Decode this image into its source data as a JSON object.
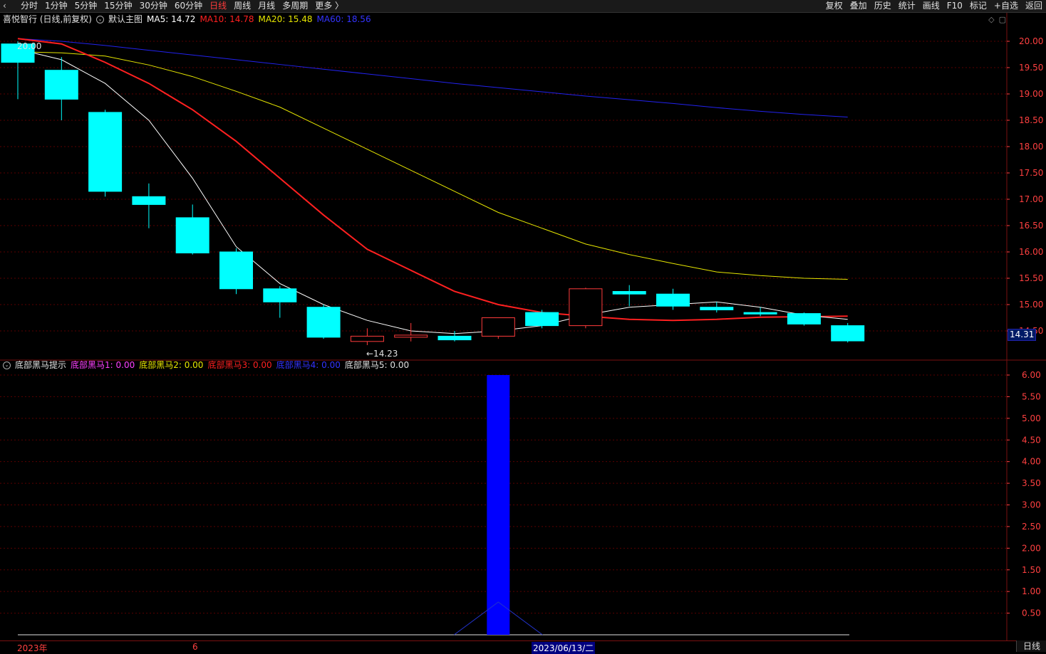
{
  "topbar": {
    "tabs": [
      "分时",
      "1分钟",
      "5分钟",
      "15分钟",
      "30分钟",
      "60分钟",
      "日线",
      "周线",
      "月线",
      "多周期",
      "更多 〉"
    ],
    "active_tab": "日线",
    "tools": [
      "复权",
      "叠加",
      "历史",
      "统计",
      "画线",
      "F10",
      "标记",
      "+自选",
      "返回"
    ]
  },
  "main_legend": {
    "stock": "喜悦智行 (日线,前复权)",
    "template": "默认主图",
    "ma5": "MA5: 14.72",
    "ma10": "MA10: 14.78",
    "ma20": "MA20: 15.48",
    "ma60": "MA60: 18.56"
  },
  "sub_legend": {
    "name": "底部黑马提示",
    "s1": "底部黑马1: 0.00",
    "s2": "底部黑马2: 0.00",
    "s3": "底部黑马3: 0.00",
    "s4": "底部黑马4: 0.00",
    "s5": "底部黑马5: 0.00"
  },
  "annotations": {
    "high": "20.00",
    "low": "←14.23"
  },
  "last_price": "14.31",
  "dates": {
    "year": "2023年",
    "month": "6",
    "cursor": "2023/06/13/二"
  },
  "period_label": "日线",
  "colors": {
    "up": "#ff3b3b",
    "down": "#00ffff",
    "ma5": "#ffffff",
    "ma10": "#ff2020",
    "ma20": "#e6e600",
    "ma60": "#2222ee",
    "grid": "#5a0000",
    "axis": "#ff4040",
    "signal_bar": "#0000ff"
  },
  "chart_data": [
    {
      "type": "candlestick",
      "title": "喜悦智行 (日线,前复权)",
      "ylim": [
        14.0,
        20.25
      ],
      "y_ticks": [
        "20.00",
        "19.50",
        "19.00",
        "18.50",
        "18.00",
        "17.50",
        "17.00",
        "16.50",
        "16.00",
        "15.50",
        "15.00",
        "14.50"
      ],
      "candles": [
        {
          "o": 19.95,
          "h": 20.0,
          "l": 18.9,
          "c": 19.6
        },
        {
          "o": 19.45,
          "h": 19.7,
          "l": 18.5,
          "c": 18.9
        },
        {
          "o": 18.65,
          "h": 18.7,
          "l": 17.05,
          "c": 17.15
        },
        {
          "o": 17.05,
          "h": 17.3,
          "l": 16.45,
          "c": 16.9
        },
        {
          "o": 16.65,
          "h": 16.9,
          "l": 15.95,
          "c": 15.98
        },
        {
          "o": 16.0,
          "h": 16.07,
          "l": 15.2,
          "c": 15.3
        },
        {
          "o": 15.3,
          "h": 15.35,
          "l": 14.75,
          "c": 15.05
        },
        {
          "o": 14.95,
          "h": 15.0,
          "l": 14.35,
          "c": 14.38
        },
        {
          "o": 14.3,
          "h": 14.55,
          "l": 14.23,
          "c": 14.4
        },
        {
          "o": 14.38,
          "h": 14.65,
          "l": 14.3,
          "c": 14.42
        },
        {
          "o": 14.4,
          "h": 14.5,
          "l": 14.3,
          "c": 14.33
        },
        {
          "o": 14.4,
          "h": 14.75,
          "l": 14.35,
          "c": 14.75
        },
        {
          "o": 14.85,
          "h": 14.9,
          "l": 14.55,
          "c": 14.6
        },
        {
          "o": 14.6,
          "h": 15.32,
          "l": 14.55,
          "c": 15.3
        },
        {
          "o": 15.25,
          "h": 15.37,
          "l": 14.97,
          "c": 15.2
        },
        {
          "o": 15.2,
          "h": 15.3,
          "l": 14.9,
          "c": 14.97
        },
        {
          "o": 14.95,
          "h": 15.05,
          "l": 14.85,
          "c": 14.9
        },
        {
          "o": 14.85,
          "h": 14.95,
          "l": 14.78,
          "c": 14.82
        },
        {
          "o": 14.83,
          "h": 14.85,
          "l": 14.6,
          "c": 14.63
        },
        {
          "o": 14.6,
          "h": 14.65,
          "l": 14.28,
          "c": 14.31
        }
      ],
      "ma5": [
        19.85,
        19.65,
        19.2,
        18.5,
        17.4,
        16.1,
        15.4,
        15.0,
        14.7,
        14.5,
        14.45,
        14.5,
        14.6,
        14.8,
        14.95,
        15.0,
        15.05,
        14.95,
        14.8,
        14.72
      ],
      "ma10": [
        20.05,
        19.95,
        19.6,
        19.2,
        18.7,
        18.1,
        17.4,
        16.7,
        16.05,
        15.65,
        15.25,
        15.0,
        14.85,
        14.78,
        14.72,
        14.7,
        14.72,
        14.76,
        14.77,
        14.78
      ],
      "ma20": [
        19.8,
        19.78,
        19.72,
        19.55,
        19.33,
        19.05,
        18.75,
        18.35,
        17.95,
        17.55,
        17.15,
        16.75,
        16.45,
        16.15,
        15.95,
        15.78,
        15.62,
        15.55,
        15.5,
        15.48
      ],
      "ma60": [
        20.05,
        20.0,
        19.92,
        19.83,
        19.74,
        19.65,
        19.56,
        19.47,
        19.38,
        19.29,
        19.2,
        19.12,
        19.04,
        18.96,
        18.89,
        18.82,
        18.74,
        18.67,
        18.61,
        18.56
      ]
    },
    {
      "type": "bar",
      "title": "底部黑马提示",
      "ylim": [
        0,
        6.4
      ],
      "y_ticks": [
        "6.00",
        "5.50",
        "5.00",
        "4.50",
        "4.00",
        "3.50",
        "3.00",
        "2.50",
        "2.00",
        "1.50",
        "1.00",
        "0.50"
      ],
      "values": [
        0,
        0,
        0,
        0,
        0,
        0,
        0,
        0,
        0,
        0,
        0,
        6.0,
        0,
        0,
        0,
        0,
        0,
        0,
        0,
        0
      ]
    }
  ]
}
